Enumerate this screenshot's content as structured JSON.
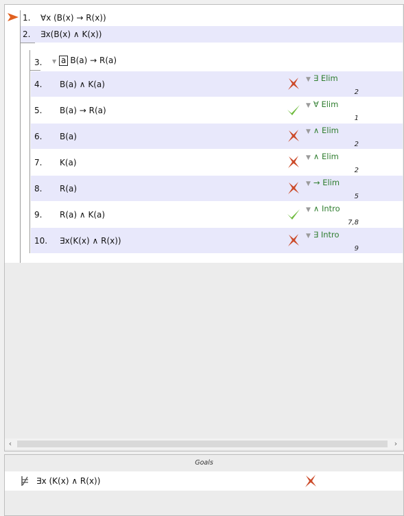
{
  "premises": [
    {
      "num": "1.",
      "formula": "∀x (B(x) → R(x))"
    },
    {
      "num": "2.",
      "formula": "∃x(B(x) ∧ K(x))"
    }
  ],
  "subproof": {
    "num": "3.",
    "boxed_const": "a",
    "assumption": "B(a) → R(a)"
  },
  "steps": [
    {
      "num": "4.",
      "formula": "B(a) ∧ K(a)",
      "status": "cross",
      "rule": "∃ Elim",
      "refs": "2"
    },
    {
      "num": "5.",
      "formula": "B(a) → R(a)",
      "status": "check",
      "rule": "∀ Elim",
      "refs": "1"
    },
    {
      "num": "6.",
      "formula": "B(a)",
      "status": "cross",
      "rule": "∧ Elim",
      "refs": "2"
    },
    {
      "num": "7.",
      "formula": "K(a)",
      "status": "cross",
      "rule": "∧ Elim",
      "refs": "2"
    },
    {
      "num": "8.",
      "formula": "R(a)",
      "status": "cross",
      "rule": "→ Elim",
      "refs": "5"
    },
    {
      "num": "9.",
      "formula": "R(a) ∧ K(a)",
      "status": "check",
      "rule": "∧ Intro",
      "refs": "7,8"
    },
    {
      "num": "10.",
      "formula": "∃x(K(x) ∧ R(x))",
      "status": "cross",
      "rule": "∃ Intro",
      "refs": "9"
    }
  ],
  "scroll": {
    "left_arrow": "‹",
    "right_arrow": "›"
  },
  "goals": {
    "title": "Goals",
    "items": [
      {
        "formula": "∃x (K(x)  ∧ R(x))",
        "status": "cross"
      }
    ]
  },
  "colors": {
    "cross": "#cc4b2a",
    "check": "#6fbb3e",
    "rule": "#2e7d2e",
    "shade": "#e8e8fb"
  }
}
